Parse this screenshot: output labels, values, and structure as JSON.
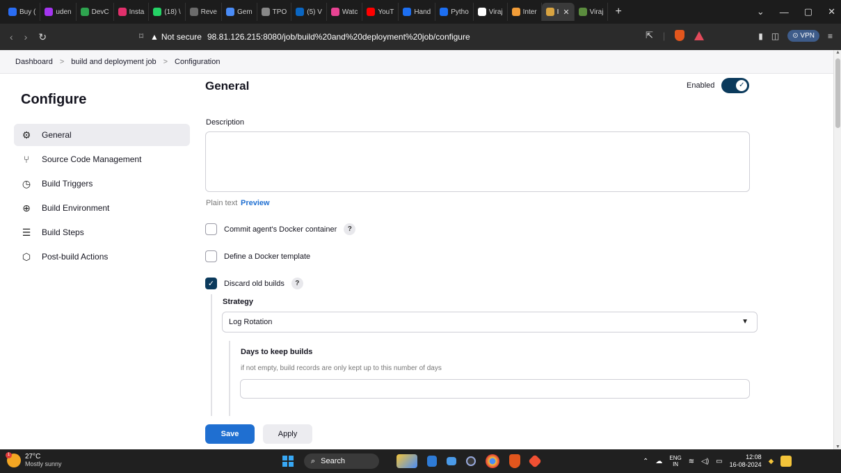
{
  "browser": {
    "tabs": [
      {
        "label": "Buy (",
        "color": "#2a6df4"
      },
      {
        "label": "uden",
        "color": "#a435f0"
      },
      {
        "label": "DevC",
        "color": "#2ea44f"
      },
      {
        "label": "Insta",
        "color": "#e1306c"
      },
      {
        "label": "(18) \\",
        "color": "#25d366"
      },
      {
        "label": "Reve",
        "color": "#6b6b6b"
      },
      {
        "label": "Gem",
        "color": "#4a8cf7"
      },
      {
        "label": "TPO",
        "color": "#888888"
      },
      {
        "label": "(5) V",
        "color": "#0a66c2"
      },
      {
        "label": "Watc",
        "color": "#e84393"
      },
      {
        "label": "YouT",
        "color": "#ff0000"
      },
      {
        "label": "Hand",
        "color": "#1d6ff2"
      },
      {
        "label": "Pytho",
        "color": "#1d6ff2"
      },
      {
        "label": "Viraj",
        "color": "#ffffff"
      },
      {
        "label": "Inter",
        "color": "#f29d38"
      },
      {
        "label": "I",
        "color": "#d9a441",
        "active": true
      },
      {
        "label": "Viraj",
        "color": "#5b8c3e"
      }
    ],
    "new_tab": "+",
    "window_controls": [
      "⌄",
      "—",
      "▢",
      "✕"
    ],
    "not_secure": "Not secure",
    "url": "98.81.126.215:8080/job/build%20and%20deployment%20job/configure",
    "vpn_label": "VPN"
  },
  "breadcrumb": {
    "items": [
      "Dashboard",
      "build and deployment job",
      "Configuration"
    ],
    "separator": ">"
  },
  "sidebar": {
    "title": "Configure",
    "items": [
      {
        "label": "General",
        "icon": "⚙"
      },
      {
        "label": "Source Code Management",
        "icon": "⑂"
      },
      {
        "label": "Build Triggers",
        "icon": "◷"
      },
      {
        "label": "Build Environment",
        "icon": "⊕"
      },
      {
        "label": "Build Steps",
        "icon": "☰"
      },
      {
        "label": "Post-build Actions",
        "icon": "⬡"
      }
    ]
  },
  "main": {
    "title": "General",
    "enabled_label": "Enabled",
    "enabled": true,
    "description_label": "Description",
    "description_value": "",
    "plain_text": "Plain text",
    "preview": "Preview",
    "options": [
      {
        "label": "Commit agent's Docker container",
        "checked": false,
        "help": "?"
      },
      {
        "label": "Define a Docker template",
        "checked": false
      },
      {
        "label": "Discard old builds",
        "checked": true,
        "help": "?"
      }
    ],
    "strategy_label": "Strategy",
    "strategy_value": "Log Rotation",
    "days_label": "Days to keep builds",
    "days_hint": "if not empty, build records are only kept up to this number of days",
    "days_value": "",
    "save": "Save",
    "apply": "Apply"
  },
  "taskbar": {
    "temp": "27°C",
    "condition": "Mostly sunny",
    "search": "Search",
    "lang_top": "ENG",
    "lang_bottom": "IN",
    "time": "12:08",
    "date": "16-08-2024",
    "weather_badge": "1"
  }
}
